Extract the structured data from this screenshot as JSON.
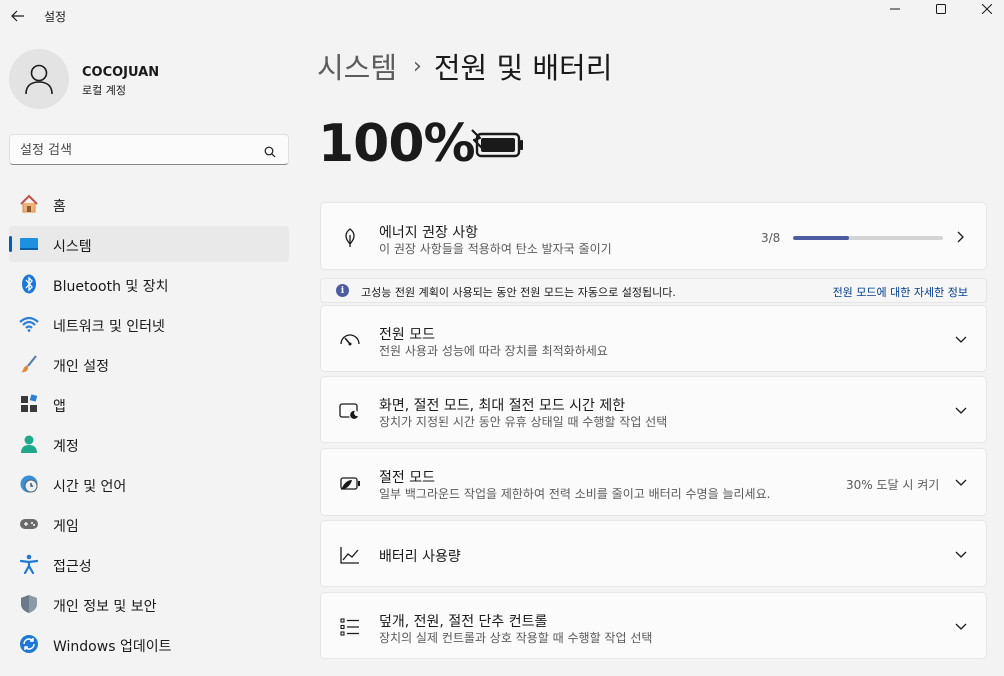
{
  "window": {
    "title": "설정"
  },
  "user": {
    "name": "COCOJUAN",
    "account_type": "로컬 계정"
  },
  "search": {
    "placeholder": "설정 검색"
  },
  "nav": [
    {
      "label": "홈",
      "icon": "home-icon"
    },
    {
      "label": "시스템",
      "icon": "system-icon",
      "selected": true
    },
    {
      "label": "Bluetooth 및 장치",
      "icon": "bluetooth-icon"
    },
    {
      "label": "네트워크 및 인터넷",
      "icon": "wifi-icon"
    },
    {
      "label": "개인 설정",
      "icon": "brush-icon"
    },
    {
      "label": "앱",
      "icon": "apps-icon"
    },
    {
      "label": "계정",
      "icon": "account-icon"
    },
    {
      "label": "시간 및 언어",
      "icon": "time-language-icon"
    },
    {
      "label": "게임",
      "icon": "gamepad-icon"
    },
    {
      "label": "접근성",
      "icon": "accessibility-icon"
    },
    {
      "label": "개인 정보 및 보안",
      "icon": "shield-icon"
    },
    {
      "label": "Windows 업데이트",
      "icon": "update-icon"
    }
  ],
  "breadcrumb": {
    "parent": "시스템",
    "separator": "›",
    "current": "전원 및 배터리"
  },
  "battery": {
    "percent": "100%",
    "charging": true
  },
  "energy": {
    "title": "에너지 권장 사항",
    "subtitle": "이 권장 사항들을 적용하여 탄소 발자국 줄이기",
    "progress_text": "3/8",
    "progress_fraction": 0.375
  },
  "info": {
    "text": "고성능 전원 계획이 사용되는 동안 전원 모드는 자동으로 설정됩니다.",
    "link": "전원 모드에 대한 자세한 정보"
  },
  "cards": {
    "power_mode": {
      "title": "전원 모드",
      "subtitle": "전원 사용과 성능에 따라 장치를 최적화하세요"
    },
    "screen_sleep": {
      "title": "화면, 절전 모드, 최대 절전 모드 시간 제한",
      "subtitle": "장치가 지정된 시간 동안 유휴 상태일 때 수행할 작업 선택"
    },
    "battery_saver": {
      "title": "절전 모드",
      "subtitle": "일부 백그라운드 작업을 제한하여 전력 소비를 줄이고 배터리 수명을 늘리세요.",
      "value": "30% 도달 시 켜기"
    },
    "battery_usage": {
      "title": "배터리 사용량"
    },
    "lid_power": {
      "title": "덮개, 전원, 절전 단추 컨트롤",
      "subtitle": "장치의 실제 컨트롤과 상호 작용할 때 수행할 작업 선택"
    }
  },
  "colors": {
    "accent": "#005fb8",
    "progress": "#4c5c9e",
    "link": "#003e92"
  }
}
